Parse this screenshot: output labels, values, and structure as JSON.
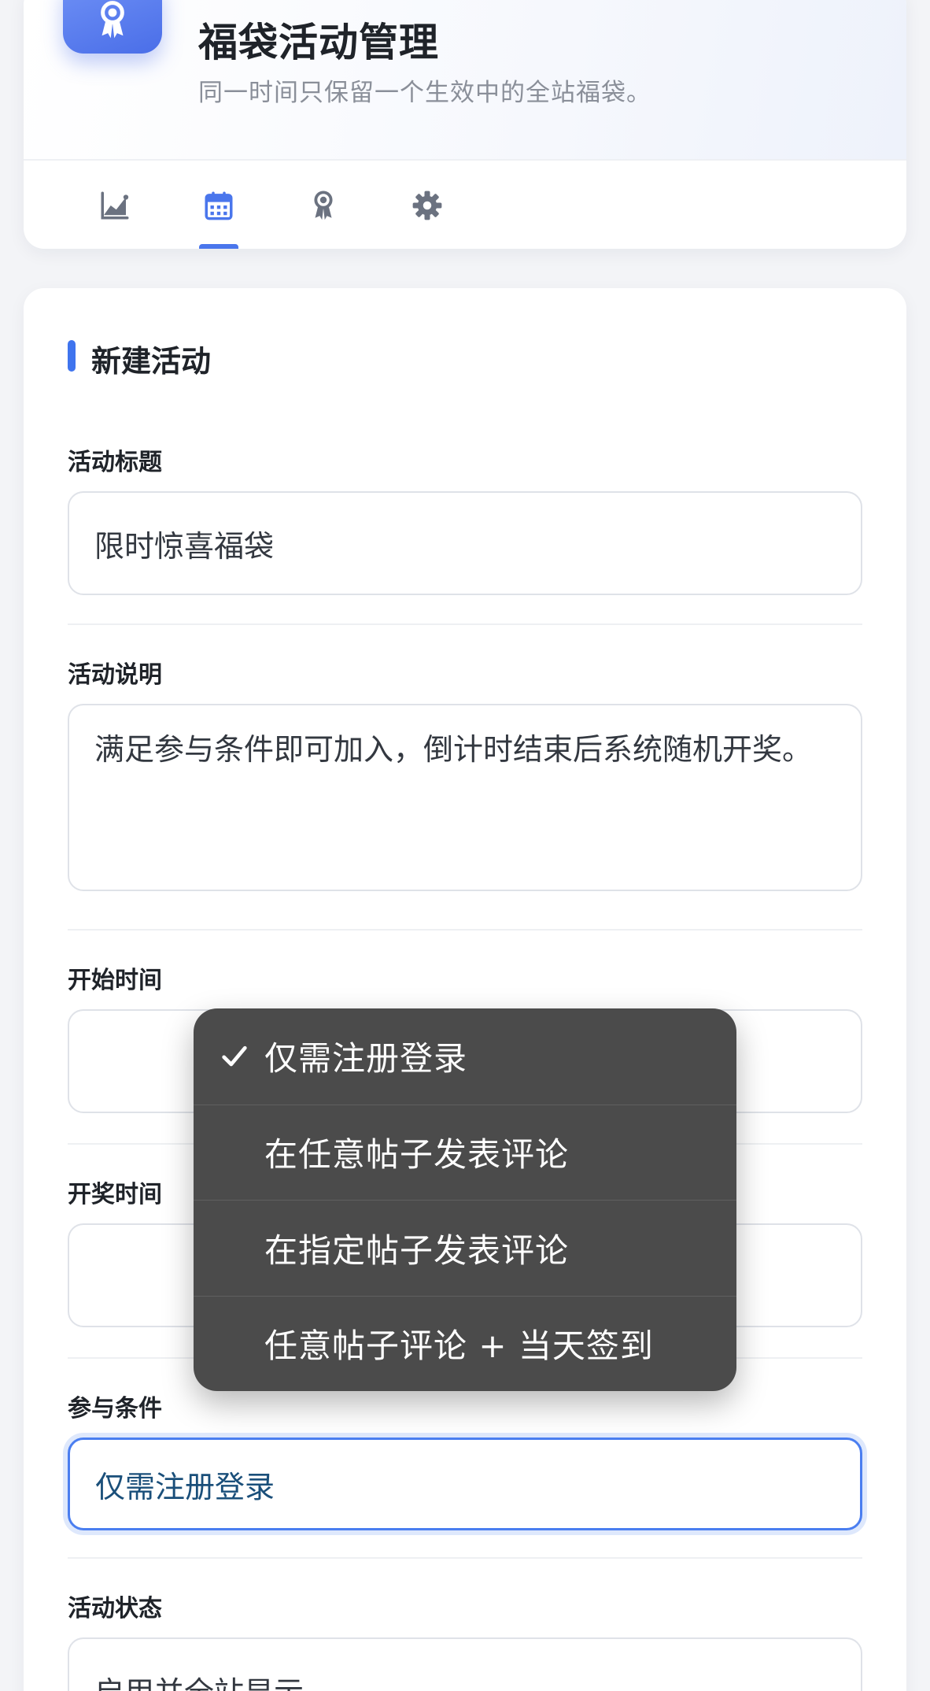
{
  "header": {
    "title": "福袋活动管理",
    "subtitle": "同一时间只保留一个生效中的全站福袋。",
    "logo_icon": "award-ribbon-icon",
    "accent_color": "#4a6ee8"
  },
  "tabs": [
    {
      "icon": "chart-area-icon",
      "active": false
    },
    {
      "icon": "calendar-icon",
      "active": true
    },
    {
      "icon": "award-ribbon-icon",
      "active": false
    },
    {
      "icon": "gear-icon",
      "active": false
    }
  ],
  "form": {
    "section_title": "新建活动",
    "fields": {
      "title": {
        "label": "活动标题",
        "value": "限时惊喜福袋"
      },
      "description": {
        "label": "活动说明",
        "value": "满足参与条件即可加入，倒计时结束后系统随机开奖。"
      },
      "start_time": {
        "label": "开始时间",
        "value": ""
      },
      "draw_time": {
        "label": "开奖时间",
        "value": ""
      },
      "condition": {
        "label": "参与条件",
        "value": "仅需注册登录"
      },
      "status": {
        "label": "活动状态",
        "value": "启用并全站显示"
      }
    }
  },
  "dropdown": {
    "selected_index": 0,
    "options": [
      "仅需注册登录",
      "在任意帖子发表评论",
      "在指定帖子发表评论",
      "任意帖子评论 + 当天签到"
    ]
  }
}
